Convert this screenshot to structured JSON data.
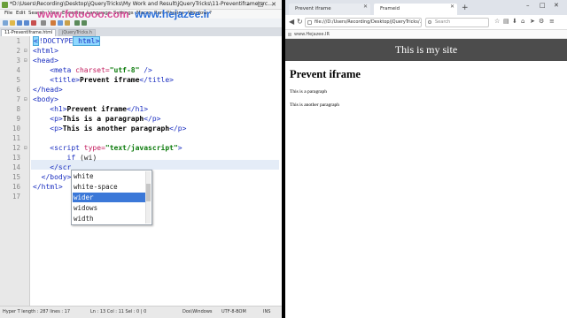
{
  "editor": {
    "title": "*D:\\Users\\Recording\\Desktop\\jQueryTricks\\My Work and Result\\jQueryTricks\\11-Preventiframe\\src...",
    "window_controls": [
      "–",
      "□",
      "✕"
    ],
    "menu": [
      "File",
      "Edit",
      "Search",
      "View",
      "Encoding",
      "Language",
      "Settings",
      "Macro",
      "Run",
      "Plugins",
      "Window",
      "?"
    ],
    "tabs": [
      "11-PreventIframe.html",
      "jQueryTricks.h"
    ],
    "watermark": [
      "www.fotoooo.com",
      "www.hejazee.ir"
    ],
    "line_numbers": [
      "1",
      "2",
      "3",
      "4",
      "5",
      "6",
      "7",
      "8",
      "9",
      "10",
      "11",
      "12",
      "13",
      "14",
      "15",
      "16",
      "17"
    ],
    "lines": [
      {
        "t": "doctype",
        "a": "<",
        "b": "!DOCTYPE",
        "c": " html>"
      },
      {
        "t": "tag",
        "text": "<html>"
      },
      {
        "t": "tag",
        "text": "<head>"
      },
      {
        "t": "meta",
        "open": "<meta ",
        "attr": "charset=",
        "val": "\"utf-8\"",
        "close": " />"
      },
      {
        "t": "title",
        "open": "<title>",
        "text": "Prevent iframe",
        "close": "</title>"
      },
      {
        "t": "tag",
        "text": "</head>"
      },
      {
        "t": "tag",
        "text": "<body>"
      },
      {
        "t": "el",
        "open": "<h1>",
        "text": "Prevent iframe",
        "close": "</h1>"
      },
      {
        "t": "el",
        "open": "<p>",
        "text": "This is a paragraph",
        "close": "</p>"
      },
      {
        "t": "el",
        "open": "<p>",
        "text": "This is another paragraph",
        "close": "</p>"
      },
      {
        "t": "blank"
      },
      {
        "t": "script",
        "open": "<script ",
        "attr": "type=",
        "val": "\"text/javascript\"",
        "close": ">"
      },
      {
        "t": "code",
        "kw": "if",
        "rest": " (wi)"
      },
      {
        "t": "tag",
        "text": "</scr"
      },
      {
        "t": "tag",
        "text": "</body>"
      },
      {
        "t": "tag",
        "text": "</html>"
      },
      {
        "t": "blank"
      }
    ],
    "autocomplete": [
      "white",
      "white-space",
      "wider",
      "widows",
      "width"
    ],
    "autocomplete_selected": 2,
    "status": [
      "Hyper T length : 287    lines : 17",
      "Ln : 13    Col : 11    Sel : 0 | 0",
      "Dos\\Windows",
      "UTF-8-BOM",
      "INS"
    ]
  },
  "browser": {
    "tabs": [
      "Prevent iframe",
      "Frameid"
    ],
    "new_tab": "+",
    "url": "file:///D:/Users/Recording/Desktop/jQueryTricks/...",
    "search_placeholder": "Search",
    "bookmark": "www.Hejazee.IR",
    "page": {
      "banner": "This is my site",
      "h1": "Prevent iframe",
      "p1": "This is a paragraph",
      "p2": "This is another paragraph"
    }
  }
}
